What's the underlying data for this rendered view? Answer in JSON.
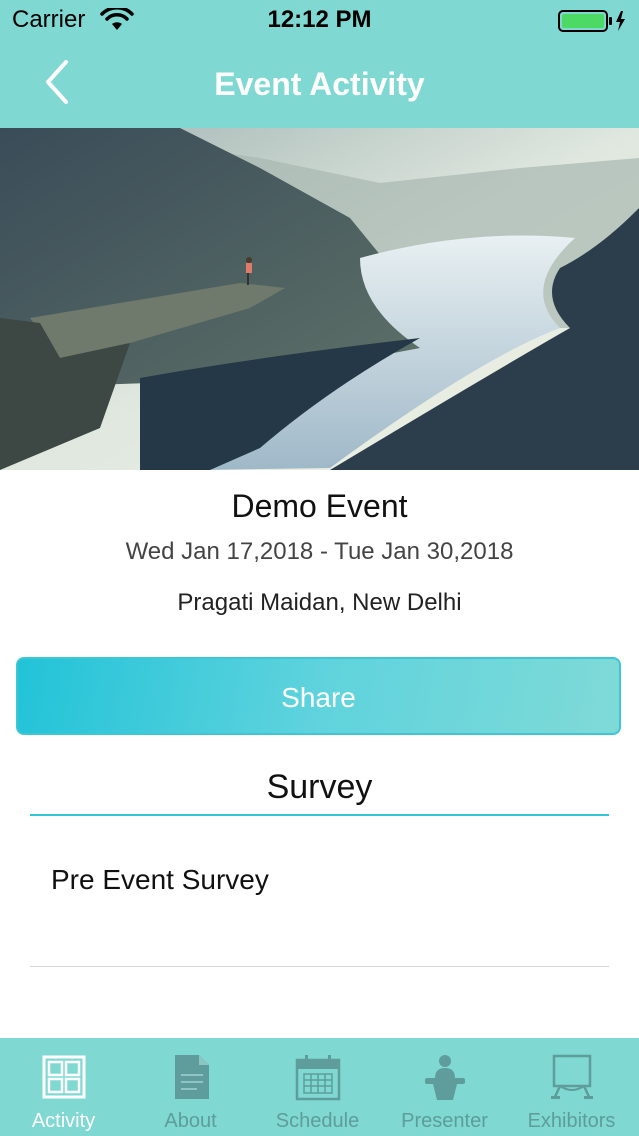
{
  "status_bar": {
    "carrier": "Carrier",
    "time": "12:12 PM"
  },
  "nav": {
    "title": "Event Activity",
    "back_icon": "chevron-left-icon"
  },
  "colors": {
    "header": "#7fd8d2",
    "accent": "#36c3d3",
    "tab_active": "#ffffff",
    "tab_inactive": "#5e9d9c"
  },
  "event": {
    "name": "Demo Event",
    "dates": "Wed Jan 17,2018 - Tue Jan 30,2018",
    "venue": "Pragati Maidan, New Delhi"
  },
  "share_label": "Share",
  "survey": {
    "heading": "Survey",
    "items": [
      {
        "label": "Pre Event Survey"
      }
    ]
  },
  "tabs": [
    {
      "label": "Activity",
      "icon": "grid-icon",
      "active": true
    },
    {
      "label": "About",
      "icon": "document-icon",
      "active": false
    },
    {
      "label": "Schedule",
      "icon": "calendar-icon",
      "active": false
    },
    {
      "label": "Presenter",
      "icon": "podium-icon",
      "active": false
    },
    {
      "label": "Exhibitors",
      "icon": "booth-icon",
      "active": false
    }
  ]
}
